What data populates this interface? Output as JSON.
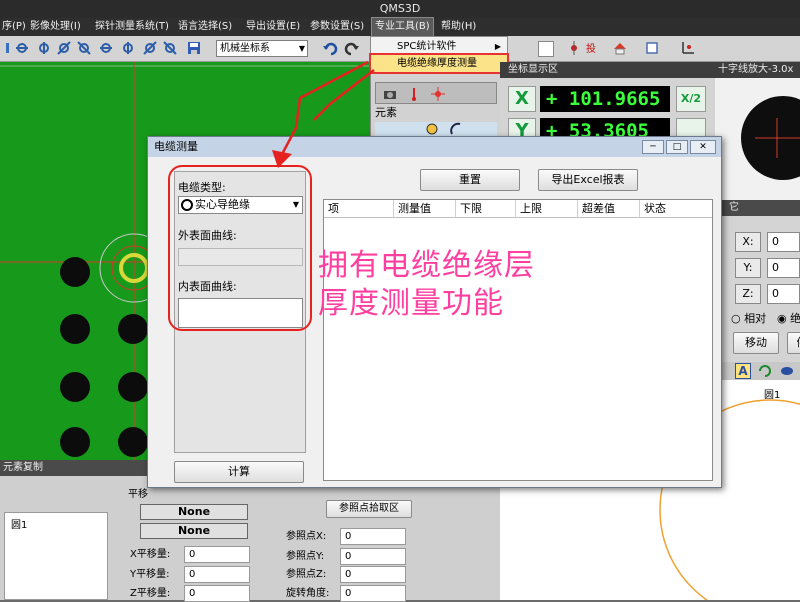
{
  "app": {
    "title": "QMS3D"
  },
  "menubar": {
    "items": [
      "序(P)",
      "影像处理(I)",
      "探针测量系统(T)",
      "语言选择(S)",
      "导出设置(E)",
      "参数设置(S)",
      "专业工具(B)",
      "帮助(H)"
    ]
  },
  "toolbar": {
    "coord_system": "机械坐标系"
  },
  "tools_menu": {
    "items": [
      "SPC统计软件",
      "电缆绝缘厚度测量"
    ],
    "highlighted": "电缆绝缘厚度测量"
  },
  "side_panel": {
    "tab": "元素"
  },
  "coord_display": {
    "title": "坐标显示区",
    "x_value": "+ 101.9665",
    "y_value": "+ 53.3605",
    "x_axis": "X",
    "y_axis": "Y",
    "half_label": "X/2"
  },
  "zoom_view": {
    "title": "十字线放大-3.0x"
  },
  "move_panel": {
    "x_label": "X:",
    "x_value": "0",
    "y_label": "Y:",
    "y_value": "0",
    "z_label": "Z:",
    "z_value": "0",
    "relative": "相对",
    "absolute": "绝",
    "move_button": "移动",
    "other_button": "停",
    "header_fragment": "它"
  },
  "view_label": "圆1",
  "element_copy": {
    "title": "元素复制",
    "list_item": "圆1",
    "panel_title_fragment": "平移",
    "none1": "None",
    "none2": "None",
    "x_shift_label": "X平移量:",
    "x_shift_value": "0",
    "y_shift_label": "Y平移量:",
    "y_shift_value": "0",
    "z_shift_label": "Z平移量:",
    "z_shift_value": "0",
    "ref_region": "参照点拾取区",
    "ref_x_label": "参照点X:",
    "ref_x_value": "0",
    "ref_y_label": "参照点Y:",
    "ref_y_value": "0",
    "ref_z_label": "参照点Z:",
    "ref_z_value": "0",
    "rotate_label": "旋转角度:",
    "rotate_value": "0"
  },
  "dialog": {
    "title": "电缆测量",
    "cable_type_label": "电缆类型:",
    "cable_type_value": "实心导绝缘",
    "outer_curve_label": "外表面曲线:",
    "inner_curve_label": "内表面曲线:",
    "calc_button": "计算",
    "reset_button": "重置",
    "export_button": "导出Excel报表",
    "table_headers": [
      "项",
      "测量值",
      "下限",
      "上限",
      "超差值",
      "状态"
    ]
  },
  "annotation": {
    "line1": "拥有电缆绝缘层",
    "line2": "厚度测量功能",
    "color": "#ff3fa0"
  },
  "colors": {
    "highlight_red": "#e5221f",
    "readout_green": "#3cff3c",
    "camera_green": "#179a1c"
  }
}
